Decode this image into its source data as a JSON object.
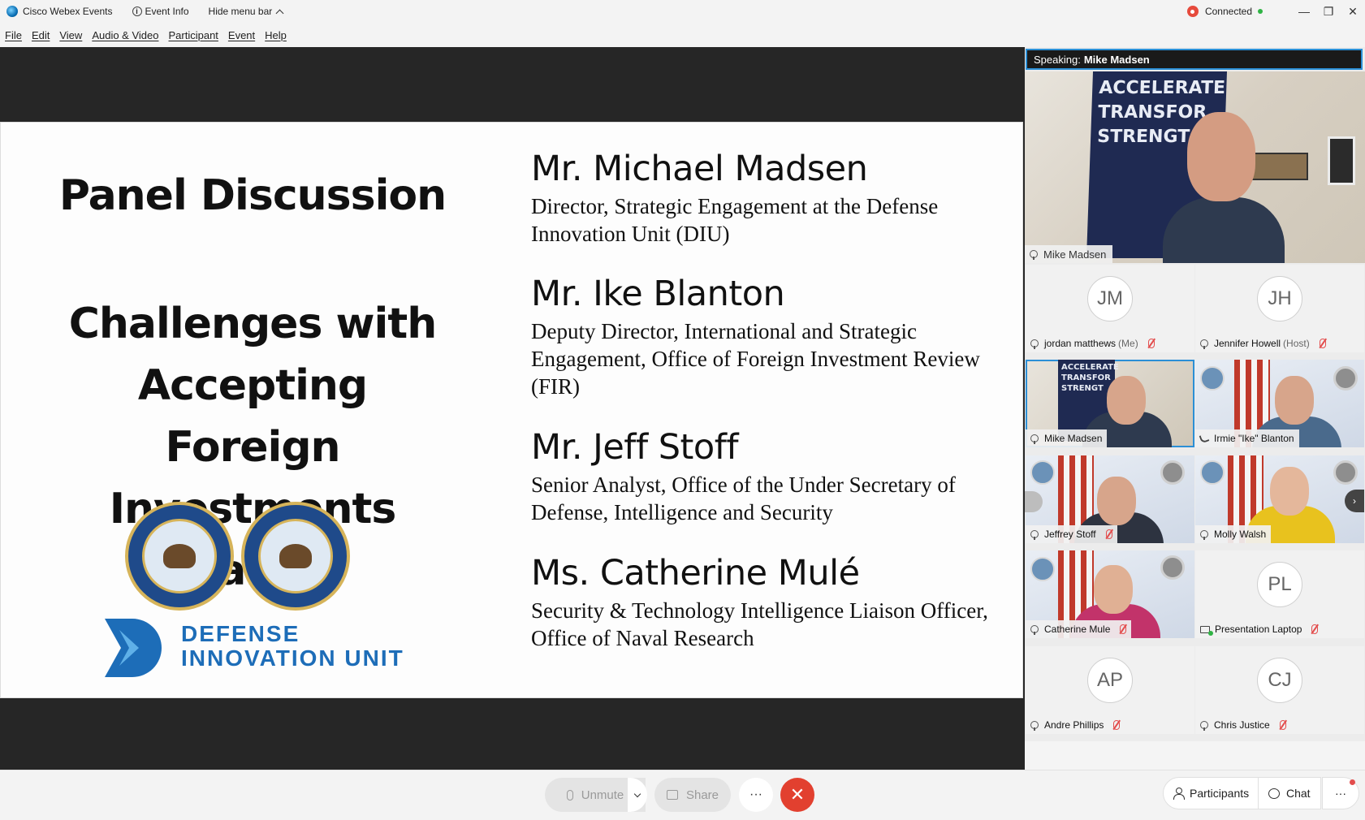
{
  "titlebar": {
    "app_name": "Cisco Webex Events",
    "event_info": "Event Info",
    "hide_menu": "Hide menu bar",
    "status": "Connected",
    "minimize": "—",
    "restore": "❐",
    "close": "✕"
  },
  "menu": [
    "File",
    "Edit",
    "View",
    "Audio & Video",
    "Participant",
    "Event",
    "Help"
  ],
  "slide": {
    "title": "Panel Discussion",
    "subtitle_lines": [
      "Challenges with",
      "Accepting Foreign",
      "Investments Panel"
    ],
    "diu_line1": "DEFENSE",
    "diu_line2": "INNOVATION UNIT",
    "speakers": [
      {
        "name": "Mr. Michael Madsen",
        "role": "Director, Strategic Engagement at the Defense Innovation Unit (DIU)"
      },
      {
        "name": "Mr. Ike Blanton",
        "role": "Deputy Director, International and Strategic Engagement, Office of Foreign Investment Review (FIR)"
      },
      {
        "name": "Mr. Jeff Stoff",
        "role": "Senior Analyst, Office of the Under Secretary of Defense, Intelligence and Security"
      },
      {
        "name": "Ms. Catherine Mulé",
        "role": "Security & Technology Intelligence Liaison Officer, Office of Naval Research"
      }
    ]
  },
  "panel": {
    "speaking_label": "Speaking:",
    "speaking_name": "Mike Madsen",
    "active_banner": [
      "ACCELERATE",
      "TRANSFOR",
      "STRENGT"
    ],
    "active_name": "Mike Madsen",
    "tiles": [
      {
        "initials": "JM",
        "name": "jordan matthews",
        "sub": "(Me)"
      },
      {
        "initials": "JH",
        "name": "Jennifer Howell",
        "sub": "(Host)"
      },
      {
        "name": "Mike Madsen",
        "banner": [
          "ACCELERATE",
          "TRANSFOR",
          "STRENGT"
        ]
      },
      {
        "name": "Irmie \"Ike\" Blanton"
      },
      {
        "name": "Jeffrey Stoff"
      },
      {
        "name": "Molly Walsh"
      },
      {
        "name": "Catherine Mule"
      },
      {
        "initials": "PL",
        "name": "Presentation Laptop"
      },
      {
        "initials": "AP",
        "name": "Andre Phillips"
      },
      {
        "initials": "CJ",
        "name": "Chris Justice"
      }
    ],
    "next_arrow": "›"
  },
  "controls": {
    "unmute": "Unmute",
    "share": "Share",
    "more": "···",
    "end": "✕",
    "participants": "Participants",
    "chat": "Chat",
    "overflow": "···"
  },
  "colors": {
    "accent": "#2b8fd6",
    "end_call": "#e2402f",
    "connected": "#2fb344",
    "mute": "#e34d4d"
  }
}
